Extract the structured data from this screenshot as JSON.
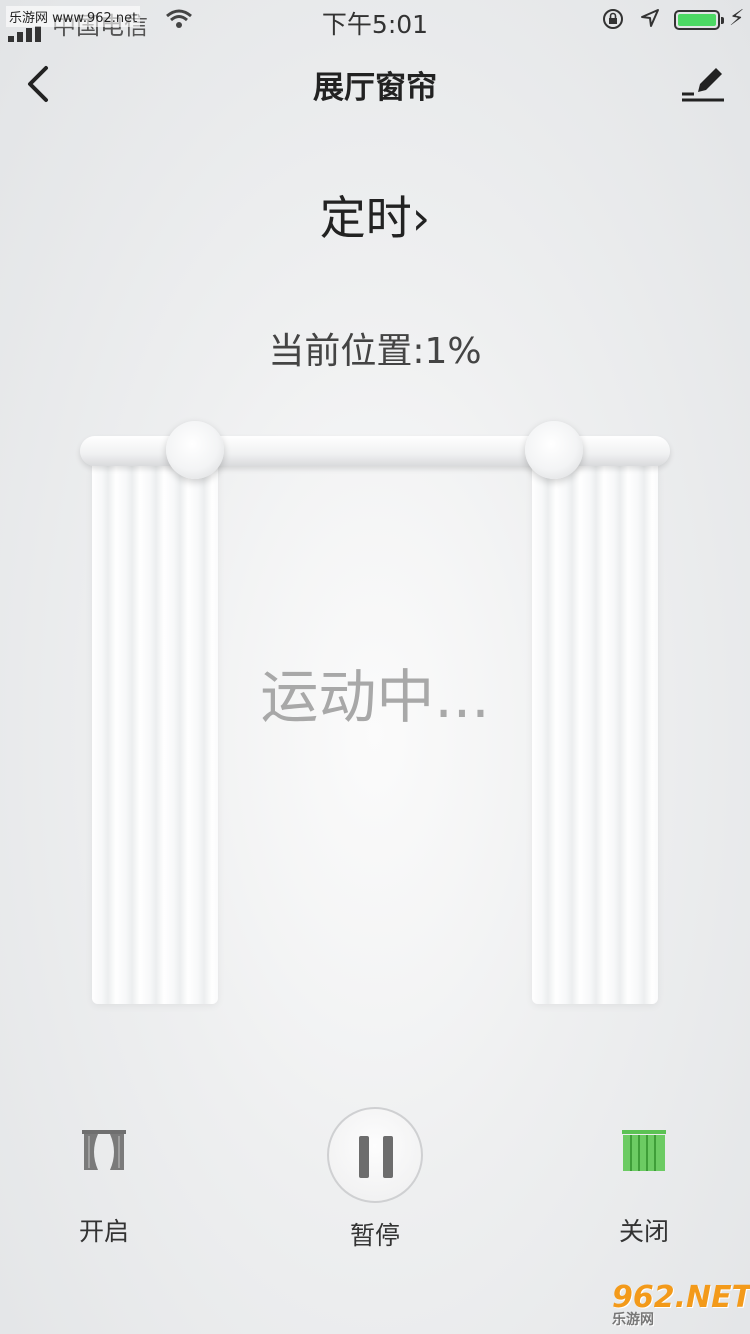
{
  "status_bar": {
    "watermark": "乐游网 www.962.net",
    "carrier": "中国电信",
    "time": "下午5:01",
    "battery_level": 1.0
  },
  "header": {
    "title": "展厅窗帘",
    "back_icon": "chevron-left-icon",
    "edit_icon": "pencil-icon"
  },
  "timer": {
    "label": "定时",
    "arrow": "›"
  },
  "position": {
    "text": "当前位置:1%",
    "value_percent": 1
  },
  "curtain": {
    "status_text": "运动中..."
  },
  "controls": {
    "open": {
      "label": "开启",
      "icon": "curtain-open-icon"
    },
    "pause": {
      "label": "暂停",
      "icon": "pause-icon"
    },
    "close": {
      "label": "关闭",
      "icon": "curtain-closed-icon",
      "color": "#5bc254"
    }
  },
  "footer_logo": {
    "main": "962.NET",
    "sub": "乐游网"
  }
}
